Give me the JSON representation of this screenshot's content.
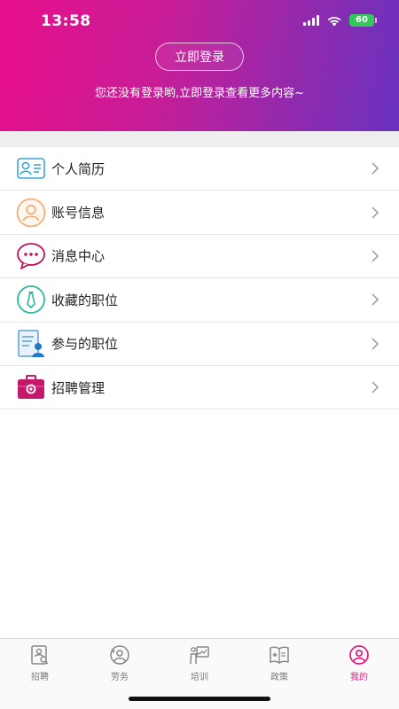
{
  "status_bar": {
    "time": "13:58",
    "battery": "60",
    "icons": [
      "signal-icon",
      "wifi-icon",
      "battery-icon"
    ]
  },
  "header": {
    "login_button": "立即登录",
    "hint": "您还没有登录哟,立即登录查看更多内容~"
  },
  "menu": {
    "items": [
      {
        "label": "个人简历",
        "icon": "resume-icon"
      },
      {
        "label": "账号信息",
        "icon": "account-icon"
      },
      {
        "label": "消息中心",
        "icon": "message-icon"
      },
      {
        "label": "收藏的职位",
        "icon": "favorite-jobs-icon"
      },
      {
        "label": "参与的职位",
        "icon": "applied-jobs-icon"
      },
      {
        "label": "招聘管理",
        "icon": "recruit-manage-icon"
      }
    ]
  },
  "tabbar": {
    "active_color": "#e5177f",
    "items": [
      {
        "label": "招聘",
        "icon": "recruit-tab-icon"
      },
      {
        "label": "劳务",
        "icon": "labor-tab-icon"
      },
      {
        "label": "培训",
        "icon": "training-tab-icon"
      },
      {
        "label": "政策",
        "icon": "policy-tab-icon"
      },
      {
        "label": "我的",
        "icon": "profile-tab-icon",
        "active": true
      }
    ]
  },
  "colors": {
    "header_gradient": [
      "#e80e8c",
      "#6a32c0"
    ],
    "accent": "#e5177f"
  }
}
